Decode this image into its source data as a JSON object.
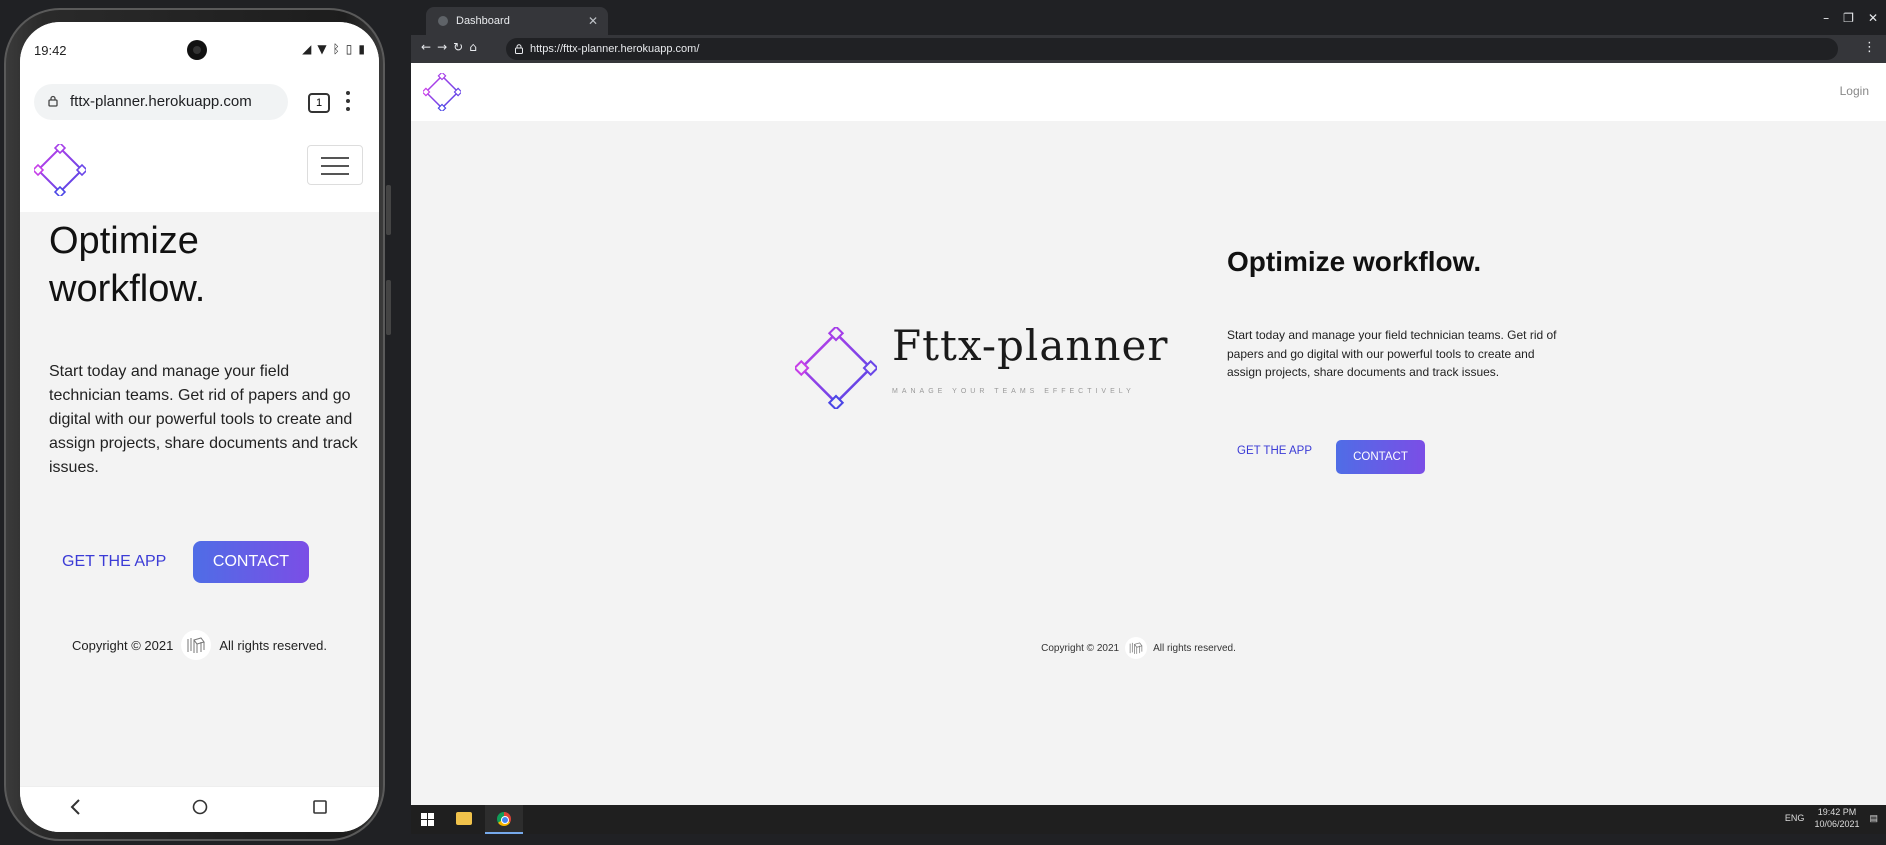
{
  "phone": {
    "status_time": "19:42",
    "url": "fttx-planner.herokuapp.com",
    "tab_count": "1",
    "heading": "Optimize workflow.",
    "body": "Start today and manage your field technician teams. Get rid of papers and go digital with our powerful tools to create and assign projects, share documents and track issues.",
    "get_app_label": "GET THE APP",
    "contact_label": "CONTACT",
    "footer_left": "Copyright © 2021",
    "footer_right": "All rights reserved."
  },
  "browser": {
    "tab_title": "Dashboard",
    "url": "https://fttx-planner.herokuapp.com/",
    "nav": {
      "login_label": "Login"
    },
    "brand": {
      "name": "Fttx-planner",
      "tagline": "MANAGE YOUR TEAMS EFFECTIVELY"
    },
    "hero": {
      "heading": "Optimize workflow.",
      "body": "Start today and manage your field technician teams. Get rid of papers and go digital with our powerful tools to create and assign projects, share documents and track issues.",
      "get_app_label": "GET THE APP",
      "contact_label": "CONTACT"
    },
    "footer": {
      "left": "Copyright © 2021",
      "right": "All rights reserved."
    }
  },
  "taskbar": {
    "language": "ENG",
    "time": "19:42 PM",
    "date": "10/06/2021"
  },
  "colors": {
    "accent_start": "#4f6de6",
    "accent_end": "#7b4ee6",
    "link_blue": "#3b3bd6",
    "page_bg": "#f3f3f3"
  },
  "icons": [
    "diamond-logo-icon",
    "menu-hamburger-icon",
    "lock-icon",
    "windows-start-icon",
    "file-explorer-icon",
    "chrome-icon"
  ]
}
